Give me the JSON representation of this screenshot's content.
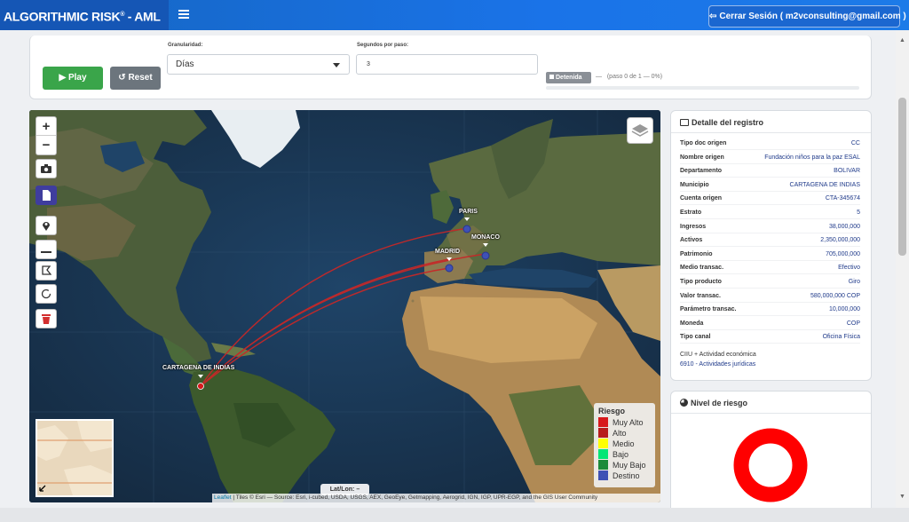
{
  "navbar": {
    "brand": "ALGORITHMIC RISK",
    "brand_reg": "®",
    "brand_suffix": " - AML",
    "logout_label": "Cerrar Sesión ( m2vconsulting@gmail.com )"
  },
  "controls": {
    "play_label": "Play",
    "reset_label": "Reset",
    "granularity_label": "Granularidad:",
    "granularity_value": "Días",
    "seconds_label": "Segundos por paso:",
    "seconds_value": "3",
    "status_badge": "Detenida",
    "status_dash": "—",
    "status_text": "(paso 0 de 1 — 0%)",
    "progress": 0
  },
  "map": {
    "zoom_in": "+",
    "zoom_out": "−",
    "latlon_label": "Lat/Lon: –",
    "attribution_link": "Leaflet",
    "attribution_text": " | Tiles © Esri — Source: Esri, i-cubed, USDA, USGS, AEX, GeoEye, Getmapping, Aerogrid, IGN, IGP, UPR-EGP, and the GIS User Community",
    "cities": {
      "origin": "CARTAGENA DE INDIAS",
      "paris": "PARIS",
      "monaco": "MONACO",
      "madrid": "MADRID"
    },
    "legend": {
      "title": "Riesgo",
      "items": [
        {
          "label": "Muy Alto",
          "color": "#d7191c"
        },
        {
          "label": "Alto",
          "color": "#b71c1c"
        },
        {
          "label": "Medio",
          "color": "#ffff00"
        },
        {
          "label": "Bajo",
          "color": "#00e676"
        },
        {
          "label": "Muy Bajo",
          "color": "#1b8a3a"
        },
        {
          "label": "Destino",
          "color": "#3f51b5"
        }
      ]
    },
    "route_color": "#c62828",
    "icons": [
      "zoom-in-icon",
      "zoom-out-icon",
      "camera-icon",
      "file-icon",
      "marker-icon",
      "polyline-icon",
      "polygon-icon",
      "circle-icon",
      "trash-icon",
      "layers-icon"
    ]
  },
  "detail": {
    "title": "Detalle del registro",
    "rows": [
      {
        "k": "Tipo doc origen",
        "v": "CC"
      },
      {
        "k": "Nombre origen",
        "v": "Fundación niños para la paz ESAL"
      },
      {
        "k": "Departamento",
        "v": "BOLIVAR"
      },
      {
        "k": "Municipio",
        "v": "CARTAGENA DE INDIAS"
      },
      {
        "k": "Cuenta origen",
        "v": "CTA-345674"
      },
      {
        "k": "Estrato",
        "v": "5"
      },
      {
        "k": "Ingresos",
        "v": "38,000,000"
      },
      {
        "k": "Activos",
        "v": "2,350,000,000"
      },
      {
        "k": "Patrimonio",
        "v": "705,000,000"
      },
      {
        "k": "Medio transac.",
        "v": "Efectivo"
      },
      {
        "k": "Tipo producto",
        "v": "Giro"
      },
      {
        "k": "Valor transac.",
        "v": "580,000,000 COP"
      },
      {
        "k": "Parámetro transac.",
        "v": "10,000,000"
      },
      {
        "k": "Moneda",
        "v": "COP"
      },
      {
        "k": "Tipo canal",
        "v": "Oficina Física"
      }
    ],
    "ciiu_label": "CIIU + Actividad económica",
    "ciiu_value": "6910 - Actividades jurídicas"
  },
  "risk": {
    "title": "Nivel de riesgo",
    "color": "#ff0000"
  }
}
